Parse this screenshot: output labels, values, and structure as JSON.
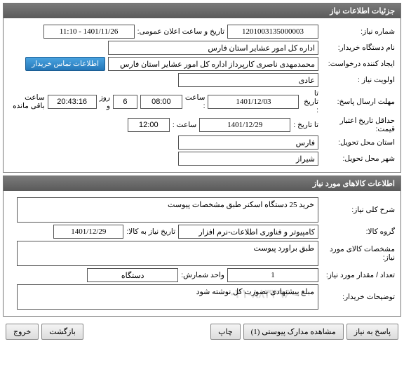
{
  "panel1": {
    "title": "جزئیات اطلاعات نیاز",
    "need_no_label": "شماره نیاز:",
    "need_no": "1201003135000003",
    "public_datetime_label": "تاریخ و ساعت اعلان عمومی:",
    "public_datetime": "1401/11/26 - 11:10",
    "buyer_org_label": "نام دستگاه خریدار:",
    "buyer_org": "اداره کل امور عشایر استان فارس",
    "requester_label": "ایجاد کننده درخواست:",
    "requester": "محمدمهدی ناصری کارپرداز اداره کل امور عشایر استان فارس",
    "buyer_contact_btn": "اطلاعات تماس خریدار",
    "priority_label": "اولویت نیاز :",
    "priority": "عادی",
    "deadline_label": "مهلت ارسال پاسخ:",
    "to_date_label": "تا تاریخ :",
    "deadline_date": "1401/12/03",
    "time_label": "ساعت :",
    "deadline_time": "08:00",
    "days_remaining": "6",
    "days_and": "روز و",
    "time_remaining": "20:43:16",
    "time_remaining_suffix": "ساعت باقی مانده",
    "valid_price_deadline_label": "حداقل تاریخ اعتبار قیمت:",
    "valid_date": "1401/12/29",
    "valid_time": "12:00",
    "province_label": "استان محل تحویل:",
    "province": "فارس",
    "city_label": "شهر محل تحویل:",
    "city": "شیراز"
  },
  "panel2": {
    "title": "اطلاعات کالاهای مورد نیاز",
    "desc_label": "شرح کلی نیاز:",
    "desc": "خرید 25 دستگاه اسکنر طبق مشخصات پیوست",
    "group_label": "گروه کالا:",
    "group": "کامپیوتر و فناوری اطلاعات-نرم افزار",
    "need_date_label": "تاریخ نیاز به کالا:",
    "need_date": "1401/12/29",
    "spec_label": "مشخصات کالای مورد نیاز:",
    "spec": "طبق براورد پیوست",
    "qty_label": "تعداد / مقدار مورد نیاز:",
    "qty": "1",
    "unit_label": "واحد شمارش:",
    "unit": "دستگاه",
    "buyer_notes_label": "توضیحات خریدار:",
    "buyer_notes": "مبلغ پیشنهادی بصورت کل نوشته شود",
    "watermark": "۰۲۱-۸۸۳۴۹۶۰"
  },
  "footer": {
    "reply": "پاسخ به نیاز",
    "attachments": "مشاهده مدارک پیوستی (1)",
    "print": "چاپ",
    "back": "بازگشت",
    "exit": "خروج"
  }
}
